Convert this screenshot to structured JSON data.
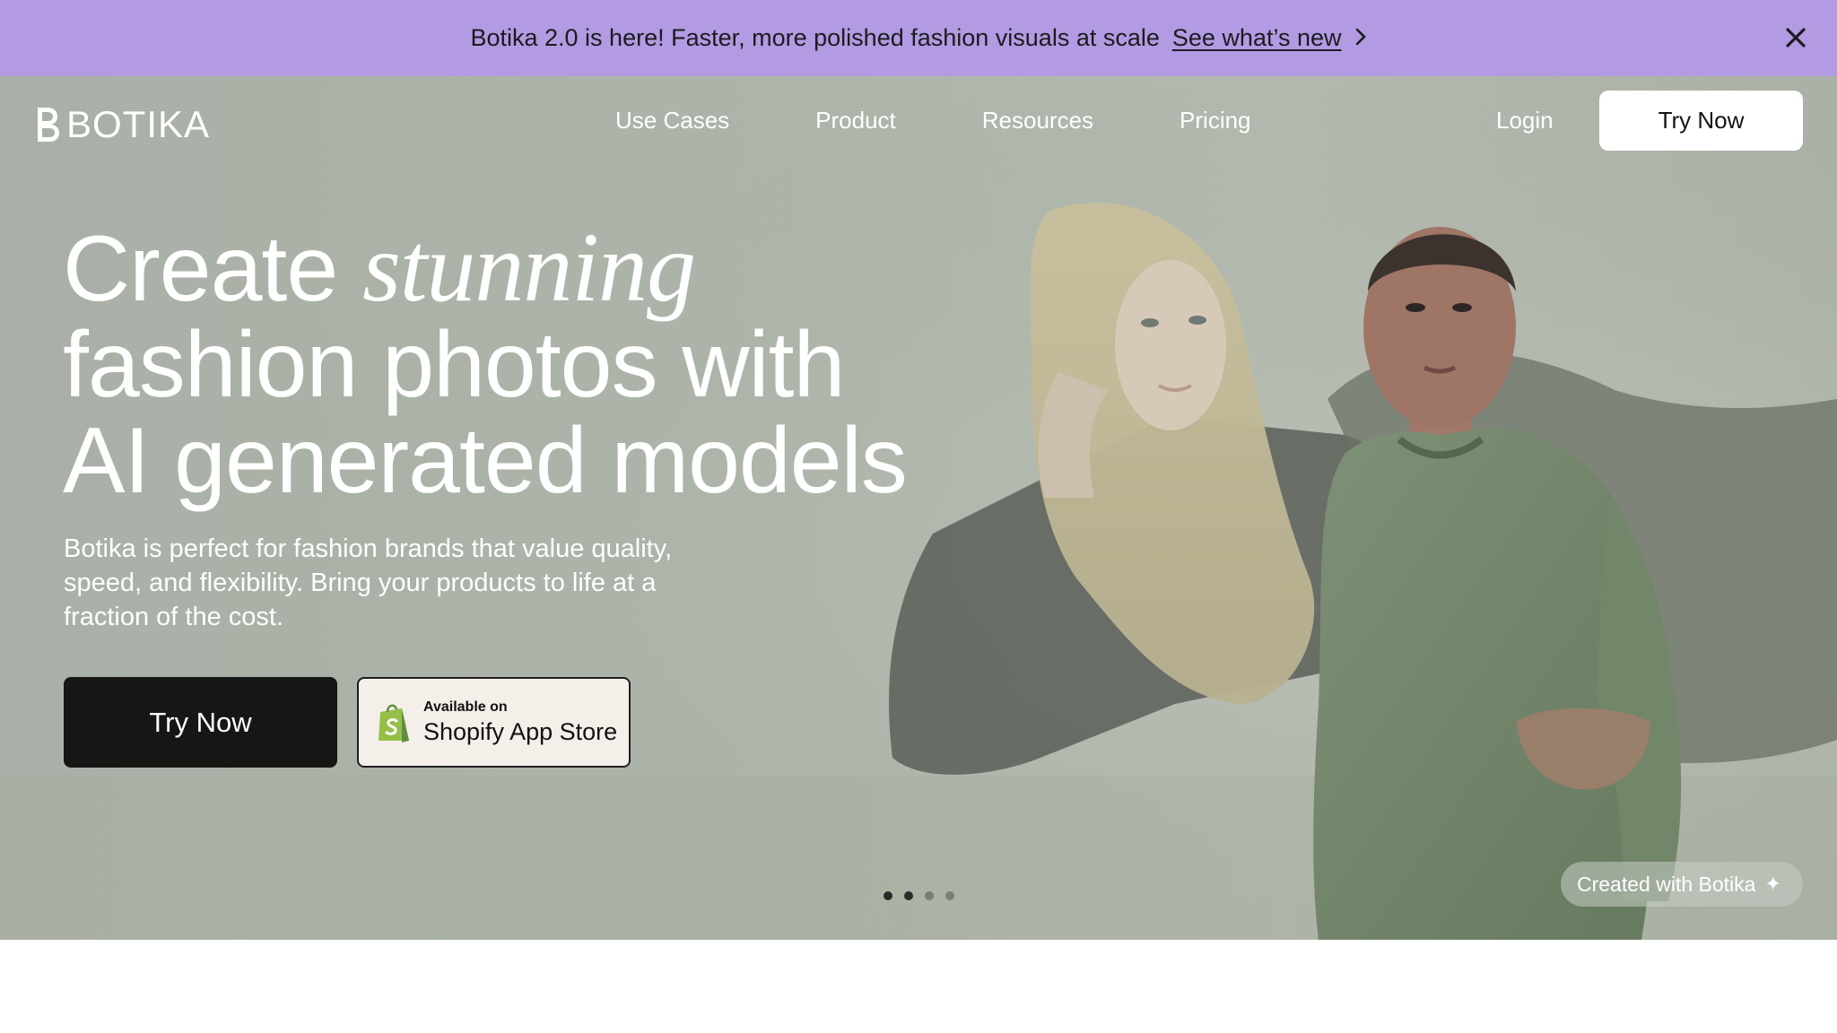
{
  "banner": {
    "text": "Botika 2.0 is here! Faster, more polished fashion visuals at scale",
    "link": "See what’s new",
    "chevron_icon": "chevron-right-icon",
    "close_icon": "close-icon",
    "background": "#b29be2"
  },
  "nav": {
    "logo_text": "BOTIKA",
    "links": [
      "Use Cases",
      "Product",
      "Resources",
      "Pricing"
    ],
    "login": "Login",
    "try_now": "Try Now"
  },
  "hero": {
    "headline_line1_plain": "Create",
    "headline_line1_italic": "stunning",
    "headline_line2": "fashion photos with",
    "headline_line3": "AI generated models",
    "subheading": "Botika is perfect for fashion brands that value quality, speed, and flexibility. Bring your products to life at a fraction of the cost.",
    "cta_primary": "Try Now",
    "shopify_small": "Available on",
    "shopify_big": "Shopify App Store",
    "carousel": {
      "slides": 4,
      "active": 2
    },
    "created_badge": "Created with Botika",
    "sparkle_icon": "sparkle-icon"
  }
}
